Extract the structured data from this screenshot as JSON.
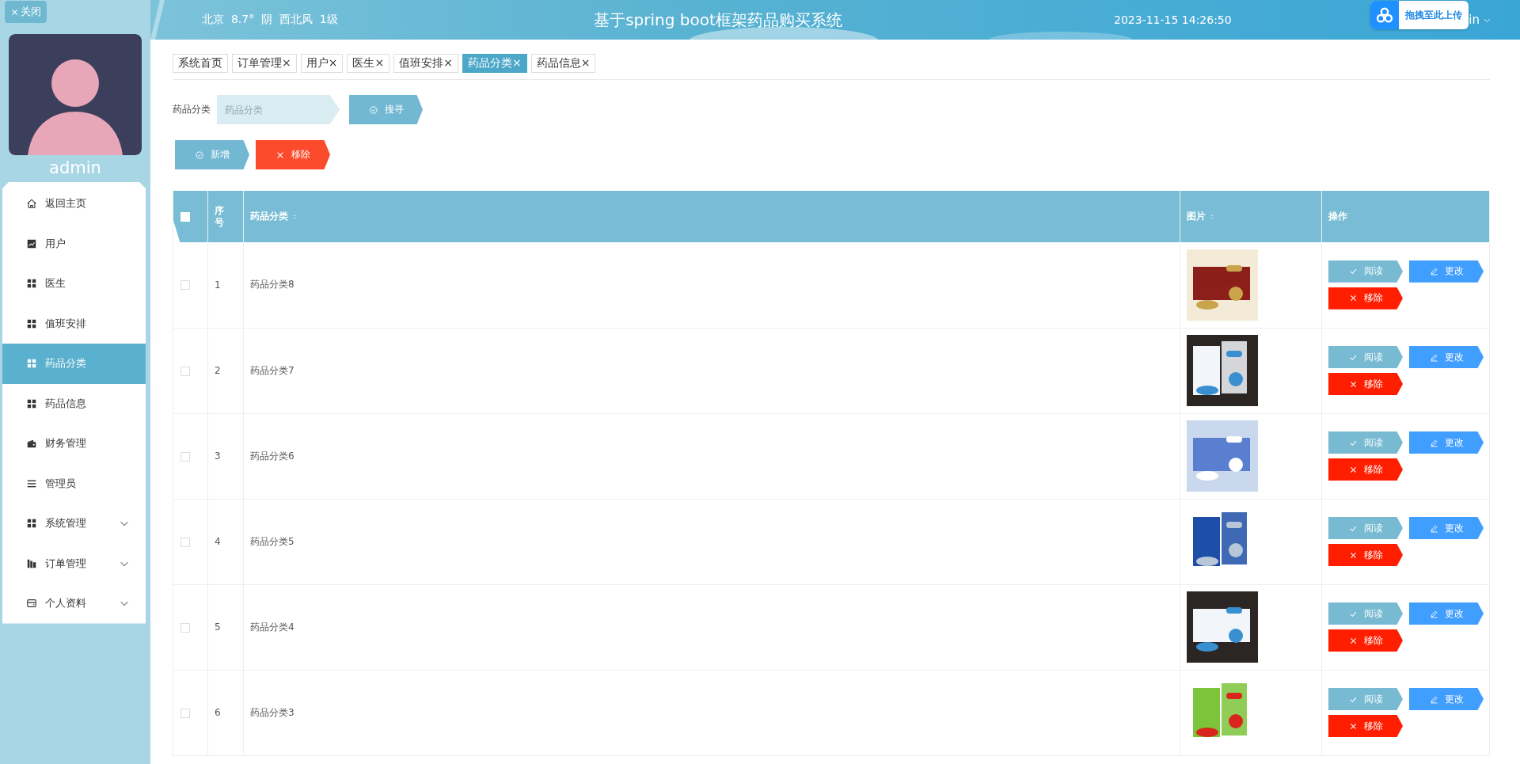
{
  "sidebar": {
    "close_button": "关闭",
    "user_name": "admin",
    "menu": [
      {
        "label": "返回主页",
        "kind": "home",
        "selected": false,
        "expandable": false
      },
      {
        "label": "用户",
        "kind": "chart",
        "selected": false,
        "expandable": false
      },
      {
        "label": "医生",
        "kind": "grid",
        "selected": false,
        "expandable": false
      },
      {
        "label": "值班安排",
        "kind": "grid",
        "selected": false,
        "expandable": false
      },
      {
        "label": "药品分类",
        "kind": "grid",
        "selected": true,
        "expandable": false
      },
      {
        "label": "药品信息",
        "kind": "grid",
        "selected": false,
        "expandable": false
      },
      {
        "label": "财务管理",
        "kind": "wallet",
        "selected": false,
        "expandable": false
      },
      {
        "label": "管理员",
        "kind": "lines",
        "selected": false,
        "expandable": false
      },
      {
        "label": "系统管理",
        "kind": "grid",
        "selected": false,
        "expandable": true
      },
      {
        "label": "订单管理",
        "kind": "bars",
        "selected": false,
        "expandable": true
      },
      {
        "label": "个人资料",
        "kind": "card",
        "selected": false,
        "expandable": true
      }
    ]
  },
  "header": {
    "weather": "北京  8.7°  阴  西北风  1级",
    "title": "基于spring boot框架药品购买系统",
    "datetime": "2023-11-15 14:26:50",
    "user_menu": "in",
    "upload_widget": "拖拽至此上传"
  },
  "tabs": [
    {
      "label": "系统首页",
      "selected": false
    },
    {
      "label": "订单管理",
      "close": "×",
      "selected": false
    },
    {
      "label": "用户",
      "close": "×",
      "selected": false
    },
    {
      "label": "医生",
      "close": "×",
      "selected": false
    },
    {
      "label": "值班安排",
      "close": "×",
      "selected": false
    },
    {
      "label": "药品分类",
      "close": "×",
      "selected": true
    },
    {
      "label": "药品信息",
      "close": "×",
      "selected": false
    }
  ],
  "search": {
    "label": "药品分类",
    "placeholder": "药品分类",
    "button": "搜寻"
  },
  "toolbar": [
    {
      "label": "新增",
      "kind": "add"
    },
    {
      "label": "移除",
      "kind": "remove"
    }
  ],
  "table": {
    "header_checked": false,
    "columns": [
      {
        "label": "序号",
        "sortable": false
      },
      {
        "label": "药品分类",
        "sortable": true
      },
      {
        "label": "图片",
        "sortable": true
      },
      {
        "label": "操作",
        "sortable": false
      }
    ],
    "rows": [
      {
        "checked": false,
        "index": "1",
        "category": "药品分类8",
        "image": {
          "kind": "picture"
        },
        "actions": [
          {
            "label": "阅读",
            "kind": "view"
          },
          {
            "label": "更改",
            "kind": "edit"
          },
          {
            "label": "移除",
            "kind": "remove"
          }
        ]
      },
      {
        "checked": false,
        "index": "2",
        "category": "药品分类7",
        "image": {
          "kind": "picture"
        },
        "actions": [
          {
            "label": "阅读",
            "kind": "view"
          },
          {
            "label": "更改",
            "kind": "edit"
          },
          {
            "label": "移除",
            "kind": "remove"
          }
        ]
      },
      {
        "checked": false,
        "index": "3",
        "category": "药品分类6",
        "image": {
          "kind": "picture"
        },
        "actions": [
          {
            "label": "阅读",
            "kind": "view"
          },
          {
            "label": "更改",
            "kind": "edit"
          },
          {
            "label": "移除",
            "kind": "remove"
          }
        ]
      },
      {
        "checked": false,
        "index": "4",
        "category": "药品分类5",
        "image": {
          "kind": "picture"
        },
        "actions": [
          {
            "label": "阅读",
            "kind": "view"
          },
          {
            "label": "更改",
            "kind": "edit"
          },
          {
            "label": "移除",
            "kind": "remove"
          }
        ]
      },
      {
        "checked": false,
        "index": "5",
        "category": "药品分类4",
        "image": {
          "kind": "picture"
        },
        "actions": [
          {
            "label": "阅读",
            "kind": "view"
          },
          {
            "label": "更改",
            "kind": "edit"
          },
          {
            "label": "移除",
            "kind": "remove"
          }
        ]
      },
      {
        "checked": false,
        "index": "6",
        "category": "药品分类3",
        "image": {
          "kind": "picture"
        },
        "actions": [
          {
            "label": "阅读",
            "kind": "view"
          },
          {
            "label": "更改",
            "kind": "edit"
          },
          {
            "label": "移除",
            "kind": "remove"
          }
        ]
      }
    ]
  }
}
